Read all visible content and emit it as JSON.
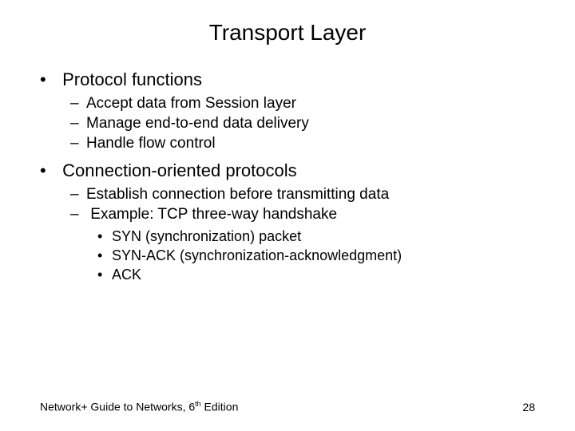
{
  "title": "Transport Layer",
  "bullets": {
    "b1": "Protocol functions",
    "b1_subs": {
      "s1": "Accept data from Session layer",
      "s2": "Manage end-to-end data delivery",
      "s3": "Handle flow control"
    },
    "b2": "Connection-oriented protocols",
    "b2_subs": {
      "s1": "Establish connection before transmitting data",
      "s2": "Example: TCP three-way handshake",
      "s2_subs": {
        "t1": "SYN (synchronization) packet",
        "t2": "SYN-ACK (synchronization-acknowledgment)",
        "t3": "ACK"
      }
    }
  },
  "footer": {
    "source_prefix": "Network+ Guide to Networks, 6",
    "source_ord": "th",
    "source_suffix": " Edition",
    "page": "28"
  }
}
